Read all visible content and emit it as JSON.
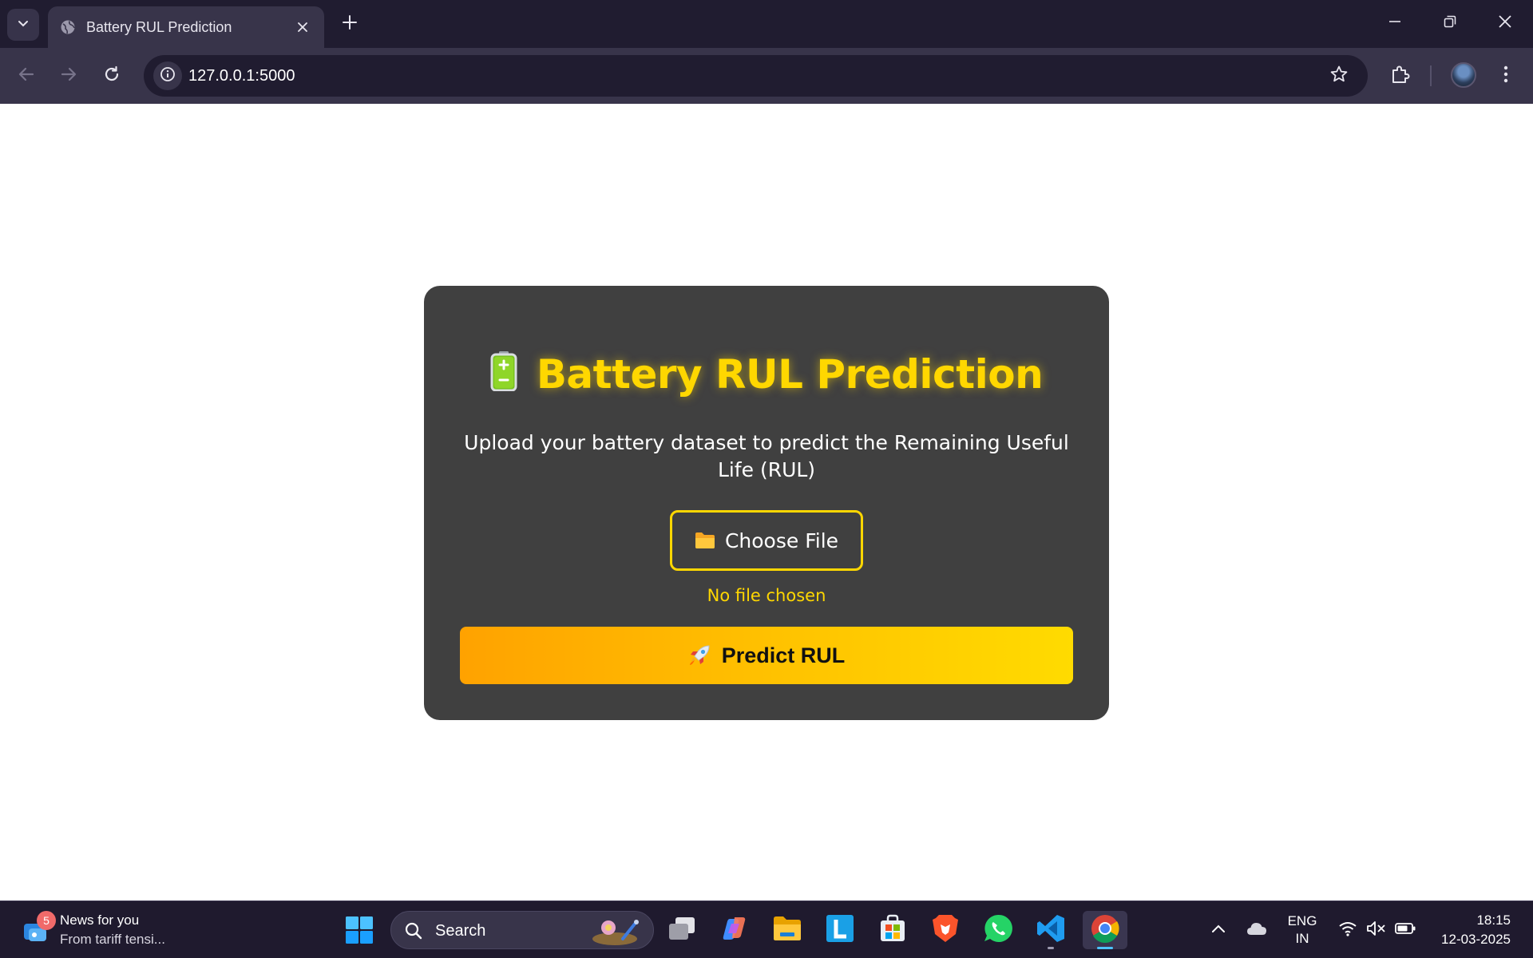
{
  "browser": {
    "tab_title": "Battery RUL Prediction",
    "url": "127.0.0.1:5000"
  },
  "page": {
    "title": "Battery RUL Prediction",
    "subtitle": "Upload your battery dataset to predict the Remaining Useful Life (RUL)",
    "choose_file_label": "Choose File",
    "file_status": "No file chosen",
    "predict_label": "Predict RUL",
    "accent_color": "#ffd700",
    "card_color": "#404040"
  },
  "taskbar": {
    "news_badge": "5",
    "news_title": "News for you",
    "news_subtitle": "From tariff tensi...",
    "search_label": "Search",
    "language_line1": "ENG",
    "language_line2": "IN",
    "time": "18:15",
    "date": "12-03-2025"
  }
}
